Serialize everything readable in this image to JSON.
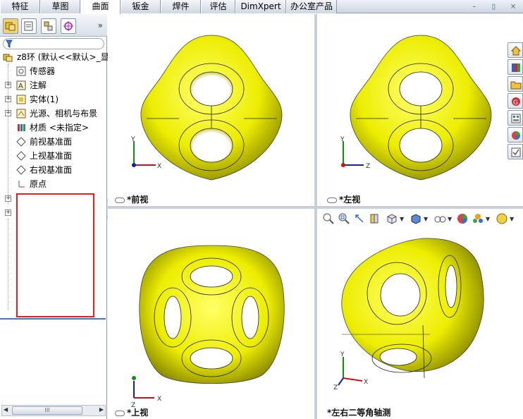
{
  "tabs": [
    {
      "label": "特征",
      "active": false
    },
    {
      "label": "草图",
      "active": false
    },
    {
      "label": "曲面",
      "active": true
    },
    {
      "label": "钣金",
      "active": false
    },
    {
      "label": "焊件",
      "active": false
    },
    {
      "label": "评估",
      "active": false
    },
    {
      "label": "DimXpert",
      "active": false
    },
    {
      "label": "办公室产品",
      "active": false
    }
  ],
  "window_controls": "- ▯ ×",
  "panel": {
    "more": "»",
    "tree": {
      "root": "z8环 (默认<<默认>_显",
      "items": [
        {
          "label": "传感器",
          "icon": "sensor-icon",
          "expandable": false
        },
        {
          "label": "注解",
          "icon": "annotation-icon",
          "expandable": true
        },
        {
          "label": "实体(1)",
          "icon": "solid-body-icon",
          "expandable": true
        },
        {
          "label": "光源、相机与布景",
          "icon": "lights-icon",
          "expandable": true
        },
        {
          "label": "材质 <未指定>",
          "icon": "material-icon",
          "expandable": false
        },
        {
          "label": "前视基准面",
          "icon": "plane-icon",
          "expandable": false
        },
        {
          "label": "上视基准面",
          "icon": "plane-icon",
          "expandable": false
        },
        {
          "label": "右视基准面",
          "icon": "plane-icon",
          "expandable": false
        },
        {
          "label": "原点",
          "icon": "origin-icon",
          "expandable": false
        }
      ]
    },
    "scroll_thumb": "III",
    "splitter": "<"
  },
  "viewports": {
    "front": {
      "label": "*前视",
      "axes": [
        "Y",
        "X"
      ]
    },
    "left": {
      "label": "*左视",
      "axes": [
        "Y",
        "Z"
      ]
    },
    "top": {
      "label": "*上视",
      "axes": [
        "X",
        "Z"
      ]
    },
    "iso": {
      "label": "*左右二等角轴测",
      "axes": [
        "Y",
        "X",
        "Z"
      ]
    }
  },
  "view_toolbar": [
    "zoom-to-fit-icon",
    "zoom-area-icon",
    "previous-view-icon",
    "section-view-icon",
    "view-orientation-icon",
    "display-style-icon",
    "hide-show-icon",
    "edit-appearance-icon",
    "scene-icon",
    "view-settings-icon"
  ],
  "taskpane": [
    "home-icon",
    "design-library-icon",
    "file-explorer-icon",
    "view-palette-icon",
    "appearances-icon",
    "custom-properties-icon",
    "task-icon"
  ],
  "colors": {
    "part_yellow": "#f2f200",
    "part_shadow": "#8a8a00",
    "axis_x": "#d01010",
    "axis_y": "#109010",
    "axis_z": "#1020c0",
    "highlight_red": "#e0201c"
  }
}
